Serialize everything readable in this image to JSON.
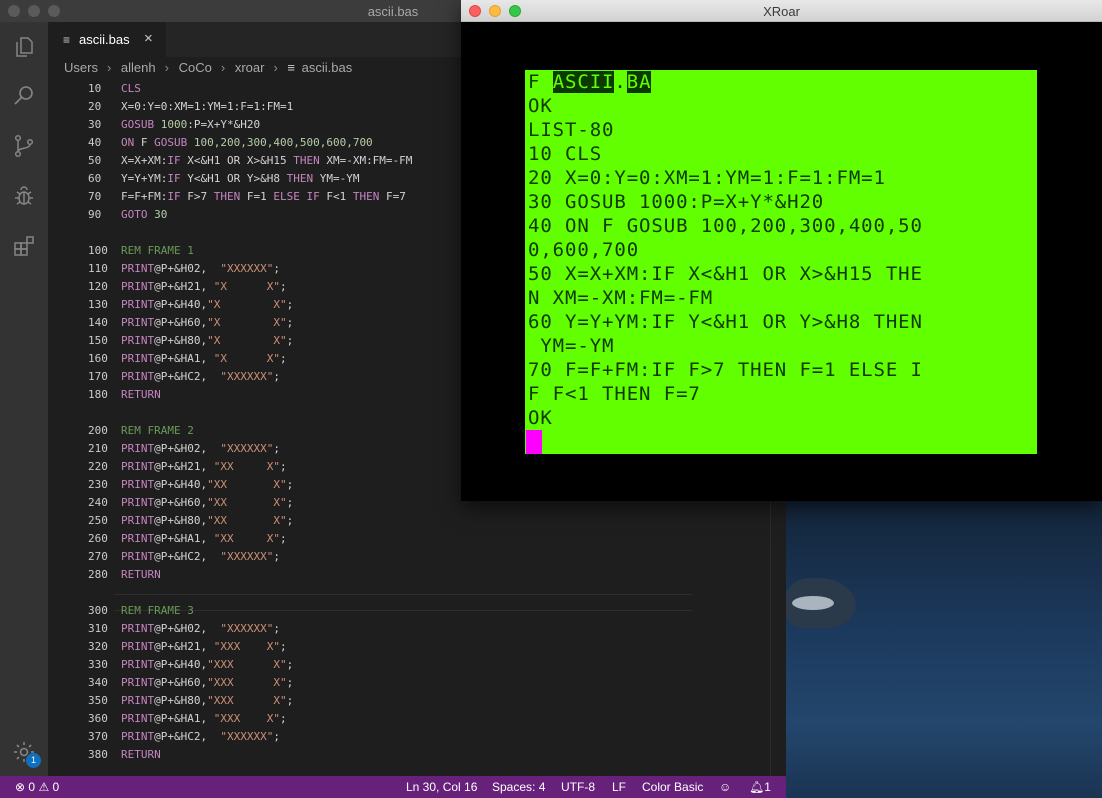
{
  "vscode": {
    "window_title": "ascii.bas",
    "tab": {
      "icon": "≡",
      "label": "ascii.bas",
      "close": "×"
    },
    "breadcrumb": [
      "Users",
      "allenh",
      "CoCo",
      "xroar",
      "ascii.bas"
    ],
    "badge": "1",
    "code_lines": [
      {
        "n": "10",
        "t": [
          [
            "kw",
            "CLS"
          ]
        ]
      },
      {
        "n": "20",
        "t": [
          [
            "txt",
            "X=0:Y=0:XM=1:YM=1:F=1:FM=1"
          ]
        ]
      },
      {
        "n": "30",
        "t": [
          [
            "kw",
            "GOSUB "
          ],
          [
            "num",
            "1000"
          ],
          [
            "txt",
            ":P=X+Y*&H20"
          ]
        ]
      },
      {
        "n": "40",
        "t": [
          [
            "kw",
            "ON "
          ],
          [
            "txt",
            "F "
          ],
          [
            "kw",
            "GOSUB "
          ],
          [
            "num",
            "100,200,300,400,500,600,700"
          ]
        ]
      },
      {
        "n": "50",
        "t": [
          [
            "txt",
            "X=X+XM:"
          ],
          [
            "kw",
            "IF "
          ],
          [
            "txt",
            "X<&H1 OR X>&H15 "
          ],
          [
            "kw",
            "THEN "
          ],
          [
            "txt",
            "XM=-XM:FM=-FM"
          ]
        ]
      },
      {
        "n": "60",
        "t": [
          [
            "txt",
            "Y=Y+YM:"
          ],
          [
            "kw",
            "IF "
          ],
          [
            "txt",
            "Y<&H1 OR Y>&H8 "
          ],
          [
            "kw",
            "THEN "
          ],
          [
            "txt",
            "YM=-YM"
          ]
        ]
      },
      {
        "n": "70",
        "t": [
          [
            "txt",
            "F=F+FM:"
          ],
          [
            "kw",
            "IF "
          ],
          [
            "txt",
            "F>7 "
          ],
          [
            "kw",
            "THEN "
          ],
          [
            "txt",
            "F=1 "
          ],
          [
            "kw",
            "ELSE IF "
          ],
          [
            "txt",
            "F<1 "
          ],
          [
            "kw",
            "THEN "
          ],
          [
            "txt",
            "F=7"
          ]
        ]
      },
      {
        "n": "90",
        "t": [
          [
            "kw",
            "GOTO "
          ],
          [
            "num",
            "30"
          ]
        ]
      },
      {
        "n": "",
        "t": []
      },
      {
        "n": "100",
        "t": [
          [
            "rem",
            "REM FRAME 1"
          ]
        ]
      },
      {
        "n": "110",
        "t": [
          [
            "kw",
            "PRINT"
          ],
          [
            "txt",
            "@P+&H02,  "
          ],
          [
            "str",
            "\"XXXXXX\""
          ],
          [
            "txt",
            ";"
          ]
        ]
      },
      {
        "n": "120",
        "t": [
          [
            "kw",
            "PRINT"
          ],
          [
            "txt",
            "@P+&H21, "
          ],
          [
            "str",
            "\"X      X\""
          ],
          [
            "txt",
            ";"
          ]
        ]
      },
      {
        "n": "130",
        "t": [
          [
            "kw",
            "PRINT"
          ],
          [
            "txt",
            "@P+&H40,"
          ],
          [
            "str",
            "\"X        X\""
          ],
          [
            "txt",
            ";"
          ]
        ]
      },
      {
        "n": "140",
        "t": [
          [
            "kw",
            "PRINT"
          ],
          [
            "txt",
            "@P+&H60,"
          ],
          [
            "str",
            "\"X        X\""
          ],
          [
            "txt",
            ";"
          ]
        ]
      },
      {
        "n": "150",
        "t": [
          [
            "kw",
            "PRINT"
          ],
          [
            "txt",
            "@P+&H80,"
          ],
          [
            "str",
            "\"X        X\""
          ],
          [
            "txt",
            ";"
          ]
        ]
      },
      {
        "n": "160",
        "t": [
          [
            "kw",
            "PRINT"
          ],
          [
            "txt",
            "@P+&HA1, "
          ],
          [
            "str",
            "\"X      X\""
          ],
          [
            "txt",
            ";"
          ]
        ]
      },
      {
        "n": "170",
        "t": [
          [
            "kw",
            "PRINT"
          ],
          [
            "txt",
            "@P+&HC2,  "
          ],
          [
            "str",
            "\"XXXXXX\""
          ],
          [
            "txt",
            ";"
          ]
        ]
      },
      {
        "n": "180",
        "t": [
          [
            "kw",
            "RETURN"
          ]
        ]
      },
      {
        "n": "",
        "t": []
      },
      {
        "n": "200",
        "t": [
          [
            "rem",
            "REM FRAME 2"
          ]
        ]
      },
      {
        "n": "210",
        "t": [
          [
            "kw",
            "PRINT"
          ],
          [
            "txt",
            "@P+&H02,  "
          ],
          [
            "str",
            "\"XXXXXX\""
          ],
          [
            "txt",
            ";"
          ]
        ]
      },
      {
        "n": "220",
        "t": [
          [
            "kw",
            "PRINT"
          ],
          [
            "txt",
            "@P+&H21, "
          ],
          [
            "str",
            "\"XX     X\""
          ],
          [
            "txt",
            ";"
          ]
        ]
      },
      {
        "n": "230",
        "t": [
          [
            "kw",
            "PRINT"
          ],
          [
            "txt",
            "@P+&H40,"
          ],
          [
            "str",
            "\"XX       X\""
          ],
          [
            "txt",
            ";"
          ]
        ]
      },
      {
        "n": "240",
        "t": [
          [
            "kw",
            "PRINT"
          ],
          [
            "txt",
            "@P+&H60,"
          ],
          [
            "str",
            "\"XX       X\""
          ],
          [
            "txt",
            ";"
          ]
        ]
      },
      {
        "n": "250",
        "t": [
          [
            "kw",
            "PRINT"
          ],
          [
            "txt",
            "@P+&H80,"
          ],
          [
            "str",
            "\"XX       X\""
          ],
          [
            "txt",
            ";"
          ]
        ]
      },
      {
        "n": "260",
        "t": [
          [
            "kw",
            "PRINT"
          ],
          [
            "txt",
            "@P+&HA1, "
          ],
          [
            "str",
            "\"XX     X\""
          ],
          [
            "txt",
            ";"
          ]
        ]
      },
      {
        "n": "270",
        "t": [
          [
            "kw",
            "PRINT"
          ],
          [
            "txt",
            "@P+&HC2,  "
          ],
          [
            "str",
            "\"XXXXXX\""
          ],
          [
            "txt",
            ";"
          ]
        ]
      },
      {
        "n": "280",
        "t": [
          [
            "kw",
            "RETURN"
          ]
        ]
      },
      {
        "n": "",
        "t": []
      },
      {
        "n": "300",
        "t": [
          [
            "rem",
            "REM FRAME 3"
          ]
        ]
      },
      {
        "n": "310",
        "t": [
          [
            "kw",
            "PRINT"
          ],
          [
            "txt",
            "@P+&H02,  "
          ],
          [
            "str",
            "\"XXXXXX\""
          ],
          [
            "txt",
            ";"
          ]
        ]
      },
      {
        "n": "320",
        "t": [
          [
            "kw",
            "PRINT"
          ],
          [
            "txt",
            "@P+&H21, "
          ],
          [
            "str",
            "\"XXX    X\""
          ],
          [
            "txt",
            ";"
          ]
        ]
      },
      {
        "n": "330",
        "t": [
          [
            "kw",
            "PRINT"
          ],
          [
            "txt",
            "@P+&H40,"
          ],
          [
            "str",
            "\"XXX      X\""
          ],
          [
            "txt",
            ";"
          ]
        ]
      },
      {
        "n": "340",
        "t": [
          [
            "kw",
            "PRINT"
          ],
          [
            "txt",
            "@P+&H60,"
          ],
          [
            "str",
            "\"XXX      X\""
          ],
          [
            "txt",
            ";"
          ]
        ]
      },
      {
        "n": "350",
        "t": [
          [
            "kw",
            "PRINT"
          ],
          [
            "txt",
            "@P+&H80,"
          ],
          [
            "str",
            "\"XXX      X\""
          ],
          [
            "txt",
            ";"
          ]
        ]
      },
      {
        "n": "360",
        "t": [
          [
            "kw",
            "PRINT"
          ],
          [
            "txt",
            "@P+&HA1, "
          ],
          [
            "str",
            "\"XXX    X\""
          ],
          [
            "txt",
            ";"
          ]
        ]
      },
      {
        "n": "370",
        "t": [
          [
            "kw",
            "PRINT"
          ],
          [
            "txt",
            "@P+&HC2,  "
          ],
          [
            "str",
            "\"XXXXXX\""
          ],
          [
            "txt",
            ";"
          ]
        ]
      },
      {
        "n": "380",
        "t": [
          [
            "kw",
            "RETURN"
          ]
        ]
      }
    ],
    "status": {
      "errors": "0",
      "warnings": "0",
      "position": "Ln 30, Col 16",
      "spaces": "Spaces: 4",
      "encoding": "UTF-8",
      "eol": "LF",
      "language": "Color Basic",
      "feedback_icon": "smiley-icon",
      "notifications": "1"
    },
    "colors": {
      "statusbar": "#68217a",
      "keyword": "#c586c0",
      "number": "#b5cea8",
      "string": "#ce9178",
      "comment": "#6a9955"
    }
  },
  "xroar": {
    "window_title": "XRoar",
    "screen_color": "#61ff00",
    "cursor_color": "#ff00ff",
    "screen_lines": [
      [
        [
          "n",
          "F "
        ],
        [
          "i",
          "ASCII"
        ],
        [
          "n",
          "."
        ],
        [
          "i",
          "BA"
        ]
      ],
      [
        [
          "n",
          "OK"
        ]
      ],
      [
        [
          "n",
          "LIST-80"
        ]
      ],
      [
        [
          "n",
          "10 CLS"
        ]
      ],
      [
        [
          "n",
          "20 X=0:Y=0:XM=1:YM=1:F=1:FM=1"
        ]
      ],
      [
        [
          "n",
          "30 GOSUB 1000:P=X+Y*&H20"
        ]
      ],
      [
        [
          "n",
          "40 ON F GOSUB 100,200,300,400,50"
        ]
      ],
      [
        [
          "n",
          "0,600,700"
        ]
      ],
      [
        [
          "n",
          "50 X=X+XM:IF X<&H1 OR X>&H15 THE"
        ]
      ],
      [
        [
          "n",
          "N XM=-XM:FM=-FM"
        ]
      ],
      [
        [
          "n",
          "60 Y=Y+YM:IF Y<&H1 OR Y>&H8 THEN"
        ]
      ],
      [
        [
          "n",
          " YM=-YM"
        ]
      ],
      [
        [
          "n",
          "70 F=F+FM:IF F>7 THEN F=1 ELSE I"
        ]
      ],
      [
        [
          "n",
          "F F<1 THEN F=7"
        ]
      ],
      [
        [
          "n",
          "OK"
        ]
      ]
    ]
  }
}
